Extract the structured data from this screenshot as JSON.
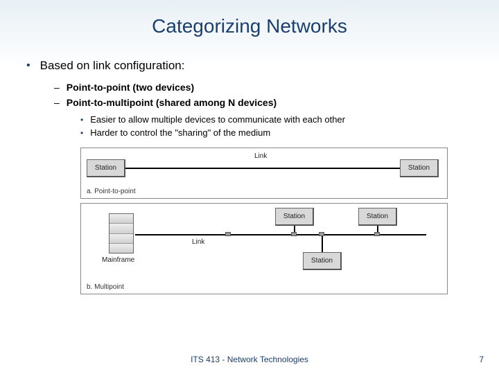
{
  "title": "Categorizing Networks",
  "bullets": {
    "l1": "Based on link configuration:",
    "l2a": "Point-to-point (two devices)",
    "l2b": "Point-to-multipoint (shared among N devices)",
    "l3a": "Easier to allow multiple devices to communicate with each other",
    "l3b": "Harder to control the \"sharing\" of the medium"
  },
  "diagram": {
    "link_label": "Link",
    "station_label": "Station",
    "mainframe_label": "Mainframe",
    "caption_a": "a. Point-to-point",
    "caption_b": "b. Multipoint"
  },
  "footer": "ITS 413 - Network Technologies",
  "page": "7"
}
